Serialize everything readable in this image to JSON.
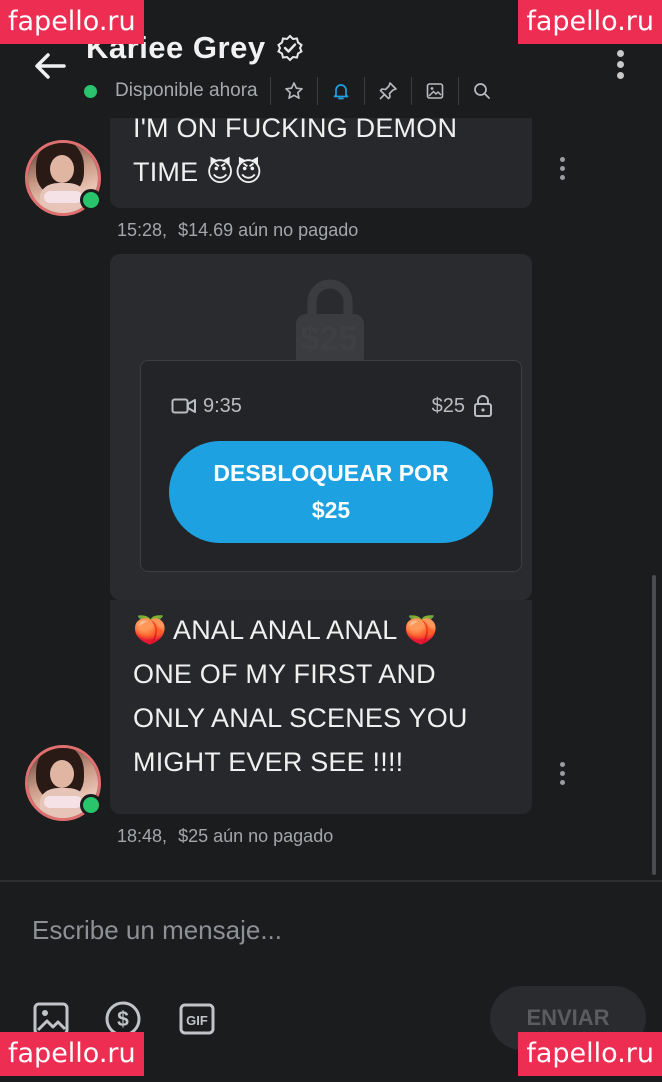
{
  "header": {
    "title": "Kariee Grey",
    "status": "Disponible ahora"
  },
  "messages": [
    {
      "text_lines": [
        "I'M ON FUCKING DEMON",
        "TIME 😈😈"
      ],
      "time": "15:28,",
      "price_status": "$14.69 aún no pagado"
    },
    {
      "locked": {
        "overlay_price": "$25",
        "duration": "9:35",
        "price": "$25",
        "unlock_line1": "DESBLOQUEAR POR",
        "unlock_line2": "$25"
      },
      "text_lines": [
        "🍑 ANAL ANAL ANAL 🍑",
        "ONE OF MY FIRST AND",
        "ONLY ANAL SCENES YOU",
        "MIGHT EVER SEE !!!!"
      ],
      "time": "18:48,",
      "price_status": "$25 aún no pagado"
    }
  ],
  "composer": {
    "placeholder": "Escribe un mensaje...",
    "send_label": "ENVIAR"
  },
  "watermark": "fapello.ru",
  "colors": {
    "background": "#1b1c1e",
    "bubble": "#27282b",
    "accent": "#1da1e0",
    "online": "#29c46b",
    "watermark": "#ee2d52"
  }
}
